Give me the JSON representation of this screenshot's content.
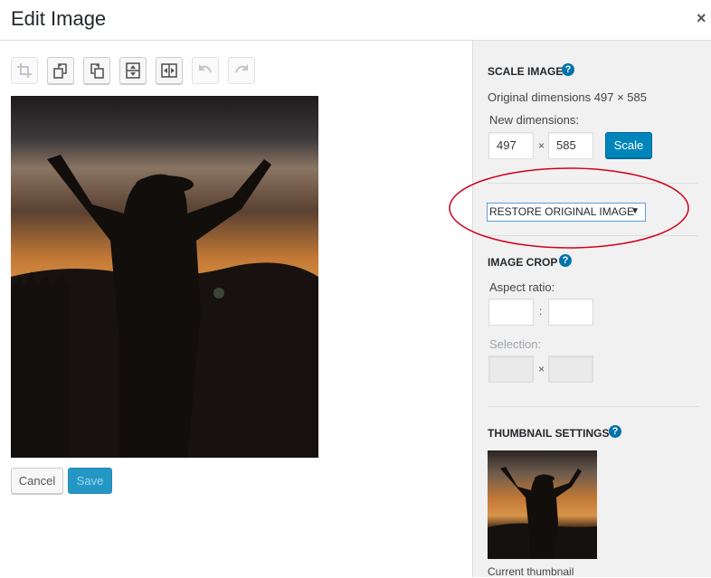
{
  "window": {
    "title": "Edit Image",
    "close_symbol": "×"
  },
  "toolbar": {
    "buttons": [
      {
        "name": "crop-icon",
        "enabled": false
      },
      {
        "name": "rotate-left-icon",
        "enabled": true
      },
      {
        "name": "rotate-right-icon",
        "enabled": true
      },
      {
        "name": "flip-vertical-icon",
        "enabled": true
      },
      {
        "name": "flip-horizontal-icon",
        "enabled": true
      },
      {
        "name": "undo-icon",
        "enabled": false
      },
      {
        "name": "redo-icon",
        "enabled": false
      }
    ]
  },
  "actions": {
    "cancel_label": "Cancel",
    "save_label": "Save"
  },
  "scale": {
    "title": "Scale Image",
    "help": "?",
    "original_dimensions": "Original dimensions 497 × 585",
    "new_dimensions_label": "New dimensions:",
    "width": "497",
    "height": "585",
    "separator": "×",
    "button_label": "Scale"
  },
  "restore": {
    "label": "RESTORE ORIGINAL IMAGE",
    "caret": "▼"
  },
  "crop": {
    "title": "Image Crop",
    "help": "?",
    "aspect_label": "Aspect ratio:",
    "aspect_width": "",
    "aspect_height": "",
    "aspect_separator": ":",
    "selection_label": "Selection:",
    "selection_width": "",
    "selection_height": "",
    "selection_separator": "×"
  },
  "thumbnail": {
    "title": "Thumbnail Settings",
    "help": "?",
    "caption": "Current thumbnail"
  },
  "colors": {
    "primary": "#0085ba",
    "annotation": "#d0021b",
    "sidebar_bg": "#f1f1f1"
  }
}
